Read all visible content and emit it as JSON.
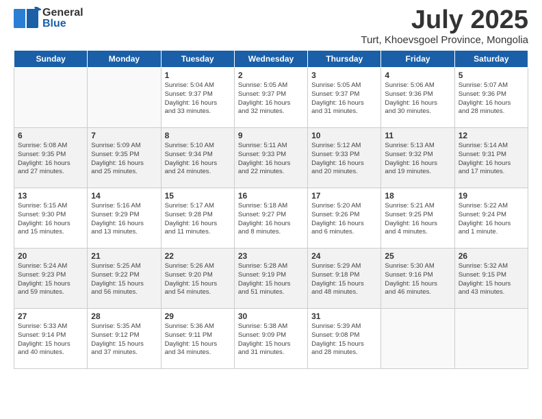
{
  "header": {
    "logo_general": "General",
    "logo_blue": "Blue",
    "month_year": "July 2025",
    "location": "Turt, Khoevsgoel Province, Mongolia"
  },
  "days_of_week": [
    "Sunday",
    "Monday",
    "Tuesday",
    "Wednesday",
    "Thursday",
    "Friday",
    "Saturday"
  ],
  "weeks": [
    {
      "alt": false,
      "days": [
        {
          "num": "",
          "empty": true,
          "text": ""
        },
        {
          "num": "",
          "empty": true,
          "text": ""
        },
        {
          "num": "1",
          "empty": false,
          "text": "Sunrise: 5:04 AM\nSunset: 9:37 PM\nDaylight: 16 hours\nand 33 minutes."
        },
        {
          "num": "2",
          "empty": false,
          "text": "Sunrise: 5:05 AM\nSunset: 9:37 PM\nDaylight: 16 hours\nand 32 minutes."
        },
        {
          "num": "3",
          "empty": false,
          "text": "Sunrise: 5:05 AM\nSunset: 9:37 PM\nDaylight: 16 hours\nand 31 minutes."
        },
        {
          "num": "4",
          "empty": false,
          "text": "Sunrise: 5:06 AM\nSunset: 9:36 PM\nDaylight: 16 hours\nand 30 minutes."
        },
        {
          "num": "5",
          "empty": false,
          "text": "Sunrise: 5:07 AM\nSunset: 9:36 PM\nDaylight: 16 hours\nand 28 minutes."
        }
      ]
    },
    {
      "alt": true,
      "days": [
        {
          "num": "6",
          "empty": false,
          "text": "Sunrise: 5:08 AM\nSunset: 9:35 PM\nDaylight: 16 hours\nand 27 minutes."
        },
        {
          "num": "7",
          "empty": false,
          "text": "Sunrise: 5:09 AM\nSunset: 9:35 PM\nDaylight: 16 hours\nand 25 minutes."
        },
        {
          "num": "8",
          "empty": false,
          "text": "Sunrise: 5:10 AM\nSunset: 9:34 PM\nDaylight: 16 hours\nand 24 minutes."
        },
        {
          "num": "9",
          "empty": false,
          "text": "Sunrise: 5:11 AM\nSunset: 9:33 PM\nDaylight: 16 hours\nand 22 minutes."
        },
        {
          "num": "10",
          "empty": false,
          "text": "Sunrise: 5:12 AM\nSunset: 9:33 PM\nDaylight: 16 hours\nand 20 minutes."
        },
        {
          "num": "11",
          "empty": false,
          "text": "Sunrise: 5:13 AM\nSunset: 9:32 PM\nDaylight: 16 hours\nand 19 minutes."
        },
        {
          "num": "12",
          "empty": false,
          "text": "Sunrise: 5:14 AM\nSunset: 9:31 PM\nDaylight: 16 hours\nand 17 minutes."
        }
      ]
    },
    {
      "alt": false,
      "days": [
        {
          "num": "13",
          "empty": false,
          "text": "Sunrise: 5:15 AM\nSunset: 9:30 PM\nDaylight: 16 hours\nand 15 minutes."
        },
        {
          "num": "14",
          "empty": false,
          "text": "Sunrise: 5:16 AM\nSunset: 9:29 PM\nDaylight: 16 hours\nand 13 minutes."
        },
        {
          "num": "15",
          "empty": false,
          "text": "Sunrise: 5:17 AM\nSunset: 9:28 PM\nDaylight: 16 hours\nand 11 minutes."
        },
        {
          "num": "16",
          "empty": false,
          "text": "Sunrise: 5:18 AM\nSunset: 9:27 PM\nDaylight: 16 hours\nand 8 minutes."
        },
        {
          "num": "17",
          "empty": false,
          "text": "Sunrise: 5:20 AM\nSunset: 9:26 PM\nDaylight: 16 hours\nand 6 minutes."
        },
        {
          "num": "18",
          "empty": false,
          "text": "Sunrise: 5:21 AM\nSunset: 9:25 PM\nDaylight: 16 hours\nand 4 minutes."
        },
        {
          "num": "19",
          "empty": false,
          "text": "Sunrise: 5:22 AM\nSunset: 9:24 PM\nDaylight: 16 hours\nand 1 minute."
        }
      ]
    },
    {
      "alt": true,
      "days": [
        {
          "num": "20",
          "empty": false,
          "text": "Sunrise: 5:24 AM\nSunset: 9:23 PM\nDaylight: 15 hours\nand 59 minutes."
        },
        {
          "num": "21",
          "empty": false,
          "text": "Sunrise: 5:25 AM\nSunset: 9:22 PM\nDaylight: 15 hours\nand 56 minutes."
        },
        {
          "num": "22",
          "empty": false,
          "text": "Sunrise: 5:26 AM\nSunset: 9:20 PM\nDaylight: 15 hours\nand 54 minutes."
        },
        {
          "num": "23",
          "empty": false,
          "text": "Sunrise: 5:28 AM\nSunset: 9:19 PM\nDaylight: 15 hours\nand 51 minutes."
        },
        {
          "num": "24",
          "empty": false,
          "text": "Sunrise: 5:29 AM\nSunset: 9:18 PM\nDaylight: 15 hours\nand 48 minutes."
        },
        {
          "num": "25",
          "empty": false,
          "text": "Sunrise: 5:30 AM\nSunset: 9:16 PM\nDaylight: 15 hours\nand 46 minutes."
        },
        {
          "num": "26",
          "empty": false,
          "text": "Sunrise: 5:32 AM\nSunset: 9:15 PM\nDaylight: 15 hours\nand 43 minutes."
        }
      ]
    },
    {
      "alt": false,
      "days": [
        {
          "num": "27",
          "empty": false,
          "text": "Sunrise: 5:33 AM\nSunset: 9:14 PM\nDaylight: 15 hours\nand 40 minutes."
        },
        {
          "num": "28",
          "empty": false,
          "text": "Sunrise: 5:35 AM\nSunset: 9:12 PM\nDaylight: 15 hours\nand 37 minutes."
        },
        {
          "num": "29",
          "empty": false,
          "text": "Sunrise: 5:36 AM\nSunset: 9:11 PM\nDaylight: 15 hours\nand 34 minutes."
        },
        {
          "num": "30",
          "empty": false,
          "text": "Sunrise: 5:38 AM\nSunset: 9:09 PM\nDaylight: 15 hours\nand 31 minutes."
        },
        {
          "num": "31",
          "empty": false,
          "text": "Sunrise: 5:39 AM\nSunset: 9:08 PM\nDaylight: 15 hours\nand 28 minutes."
        },
        {
          "num": "",
          "empty": true,
          "text": ""
        },
        {
          "num": "",
          "empty": true,
          "text": ""
        }
      ]
    }
  ]
}
